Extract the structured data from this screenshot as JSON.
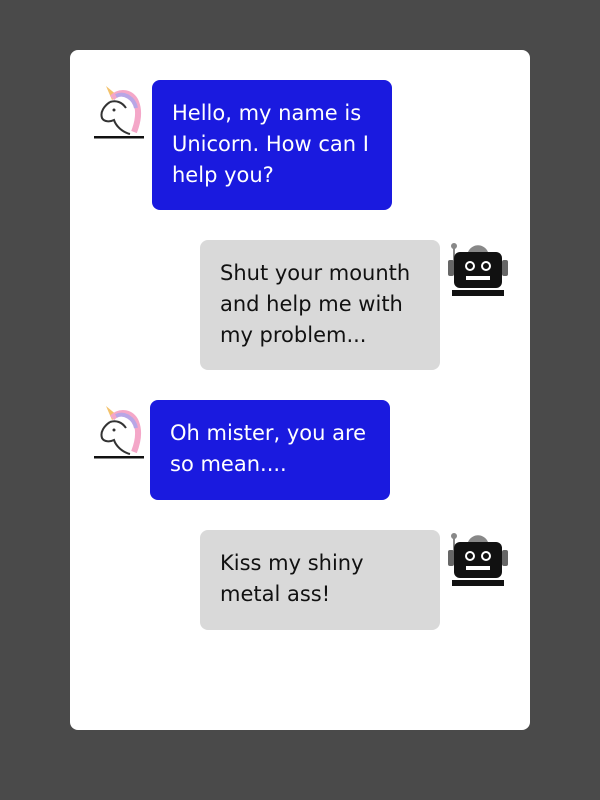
{
  "colors": {
    "page_background": "#4a4a4a",
    "card_background": "#ffffff",
    "unicorn_bubble": "#1a1adf",
    "robot_bubble": "#d9d9d9"
  },
  "conversation": {
    "messages": [
      {
        "sender": "unicorn",
        "avatar_icon": "unicorn-icon",
        "text": "Hello, my name is Unicorn. How can I help you?"
      },
      {
        "sender": "robot",
        "avatar_icon": "robot-icon",
        "text": "Shut your mounth and help me with my problem..."
      },
      {
        "sender": "unicorn",
        "avatar_icon": "unicorn-icon",
        "text": "Oh mister, you are so mean...."
      },
      {
        "sender": "robot",
        "avatar_icon": "robot-icon",
        "text": "Kiss my shiny metal ass!"
      }
    ]
  }
}
